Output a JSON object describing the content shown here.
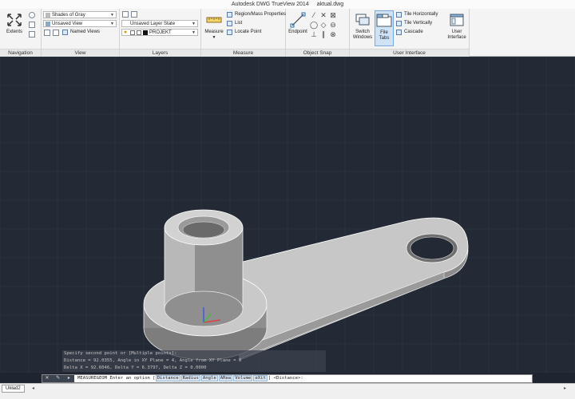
{
  "window": {
    "app_title": "Autodesk DWG TrueView 2014",
    "file_name": "aktual.dwg"
  },
  "ribbon": {
    "navigation": {
      "label": "Navigation",
      "extents_label": "Extents"
    },
    "view": {
      "label": "View",
      "visual_style": "Shades of Gray",
      "saved_view": "Unsaved View",
      "named_views_label": "Named Views"
    },
    "layers": {
      "label": "Layers",
      "layer_state": "Unsaved Layer State",
      "current_layer": "PROJEKT"
    },
    "measure": {
      "label": "Measure",
      "measure_button": "Measure",
      "region_mass": "Region/Mass Properties",
      "list": "List",
      "locate_point": "Locate Point"
    },
    "object_snap": {
      "label": "Object Snap",
      "endpoint_label": "Endpoint"
    },
    "user_interface": {
      "label": "User Interface",
      "switch_windows_line1": "Switch",
      "switch_windows_line2": "Windows",
      "file_tabs": "File Tabs",
      "tile_horizontally": "Tile Horizontally",
      "tile_vertically": "Tile Vertically",
      "cascade": "Cascade",
      "user_interface_line1": "User",
      "user_interface_line2": "Interface"
    }
  },
  "command_history": [
    "Specify second point or [Multiple points]:",
    "Distance = 92.0355,  Angle in XY Plane = 4,  Angle from XY Plane = 0",
    "Delta X = 92.6046,  Delta Y = 6.3797,  Delta Z = 0.0000"
  ],
  "command_line": {
    "prefix": "MEASUREGEOM Enter an option",
    "options": [
      "Distance",
      "Radius",
      "Angle",
      "ARea",
      "Volume",
      "eXit"
    ],
    "suffix": "<Distance>:",
    "button_close": "✕",
    "button_settings": "✎",
    "button_recent": "▸"
  },
  "status_bar": {
    "layout_tab": "Układ2"
  },
  "colors": {
    "viewport_bg": "#232a35",
    "grid": "#2f3846",
    "part_light": "#cfcfcf",
    "part_mid": "#a9a9a9",
    "part_dark": "#7d7d7d",
    "ucs_x": "#e04040",
    "ucs_y": "#40c040",
    "ucs_z": "#4060e0"
  }
}
